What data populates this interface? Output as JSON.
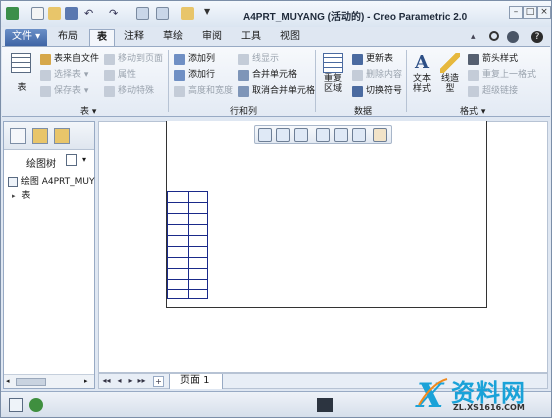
{
  "window": {
    "title": "A4PRT_MUYANG (活动的) - Creo Parametric 2.0"
  },
  "tabs": [
    "文件",
    "布局",
    "表",
    "注释",
    "草绘",
    "审阅",
    "工具",
    "视图"
  ],
  "active_tab": "表",
  "ribbon": {
    "table_group": {
      "label": "表",
      "table_btn": "表",
      "from_file": "表来自文件",
      "select_table": "选择表",
      "save_table": "保存表",
      "move_to_page": "移动到页面",
      "properties": "属性",
      "move_special": "移动特殊"
    },
    "rowcol_group": {
      "label": "行和列",
      "add_column": "添加列",
      "add_row": "添加行",
      "height_width": "高度和宽度",
      "show_lines": "线显示",
      "merge_cells": "合并单元格",
      "unmerge_cells": "取消合并单元格"
    },
    "data_group": {
      "label": "数据",
      "repeat_region": "重复区域",
      "update_table": "更新表",
      "delete_content": "删除内容",
      "switch_symbol": "切换符号"
    },
    "format_group": {
      "label": "格式",
      "text_style": "文本样式",
      "line_style": "线造型",
      "arrow_style": "箭头样式",
      "repeat_last_format": "重复上一格式",
      "hyperlink": "超级链接"
    }
  },
  "navigator": {
    "header": "绘图树",
    "tree": [
      {
        "label": "绘图 A4PRT_MUY"
      },
      {
        "label": "表"
      }
    ]
  },
  "pagebar": {
    "page_tab": "页面 1",
    "add_page": "+"
  },
  "watermark": {
    "title": "资料网",
    "url": "ZL.XS1616.COM"
  },
  "colors": {
    "accent": "#3f65a5",
    "table_lines": "#1a2a8a",
    "ribbon_bg": "#e3eaf4"
  }
}
